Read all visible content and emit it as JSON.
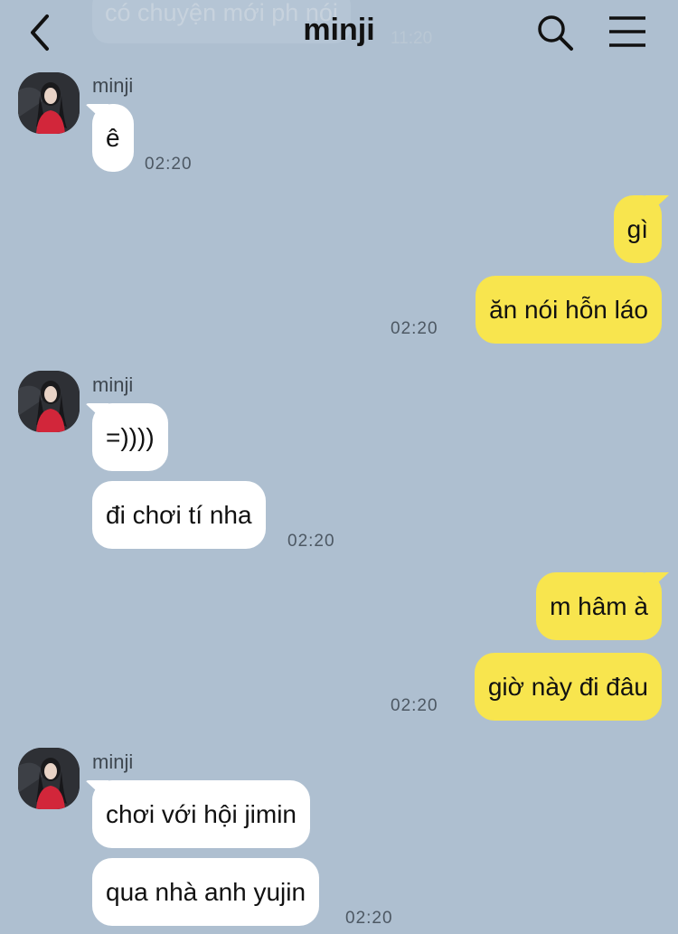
{
  "header": {
    "title": "minji",
    "ghost_text": "có chuyện mới ph nói",
    "ghost_time": "11:20"
  },
  "icons": {
    "back": "back-arrow-icon",
    "search": "search-icon",
    "menu": "hamburger-menu-icon"
  },
  "colors": {
    "background": "#aebfd0",
    "incoming_bubble": "#ffffff",
    "outgoing_bubble": "#f8e54e"
  },
  "messages": {
    "g1": {
      "sender": "minji",
      "m1": "ê",
      "time": "02:20"
    },
    "g2": {
      "m1": "gì",
      "m2": "ăn nói hỗn láo",
      "time": "02:20"
    },
    "g3": {
      "sender": "minji",
      "m1": "=))))",
      "m2": "đi chơi tí nha",
      "time": "02:20"
    },
    "g4": {
      "m1": "m hâm à",
      "m2": "giờ này đi đâu",
      "time": "02:20"
    },
    "g5": {
      "sender": "minji",
      "m1": "chơi với hội jimin",
      "m2": "qua nhà anh yujin",
      "time": "02:20"
    }
  }
}
